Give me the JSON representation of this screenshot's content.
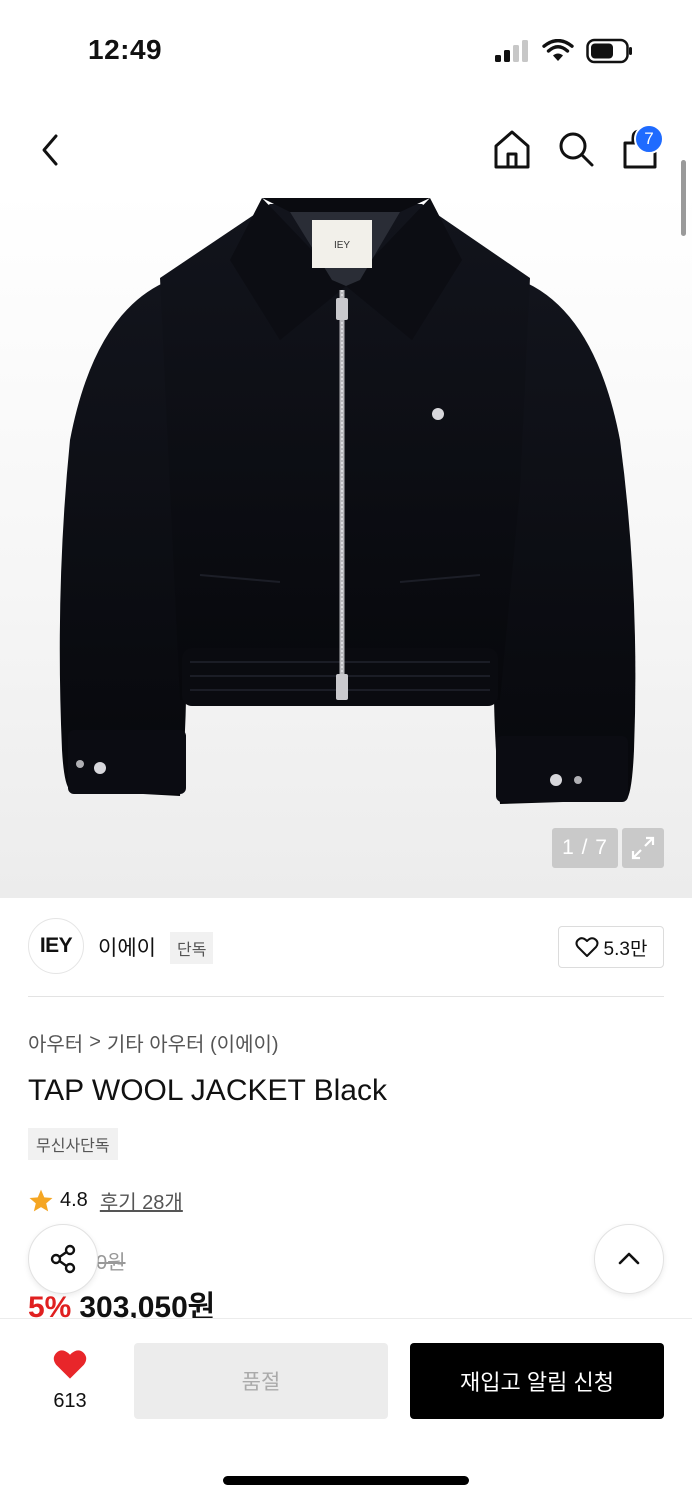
{
  "status_bar": {
    "time": "12:49"
  },
  "nav": {
    "bag_count": "7"
  },
  "gallery": {
    "counter": "1 / 7",
    "label_text": "IEY"
  },
  "brand": {
    "logo_text": "IEY",
    "name": "이에이",
    "tag": "단독",
    "likes": "5.3만"
  },
  "breadcrumb": {
    "level1": "아우터",
    "separator": ">",
    "level2": "기타 아우터 (이에이)"
  },
  "product": {
    "title": "TAP WOOL JACKET Black",
    "exclusive_tag": "무신사단독",
    "rating": "4.8",
    "reviews": "후기 28개",
    "original_price": "0원",
    "discount": "5%",
    "price": "303,050원"
  },
  "bottom_bar": {
    "wish_count": "613",
    "soldout_label": "품절",
    "restock_label": "재입고 알림 신청"
  },
  "colors": {
    "accent_blue": "#1f6bff",
    "discount_red": "#e02020",
    "star": "#f5a623",
    "heart": "#e8262a"
  }
}
